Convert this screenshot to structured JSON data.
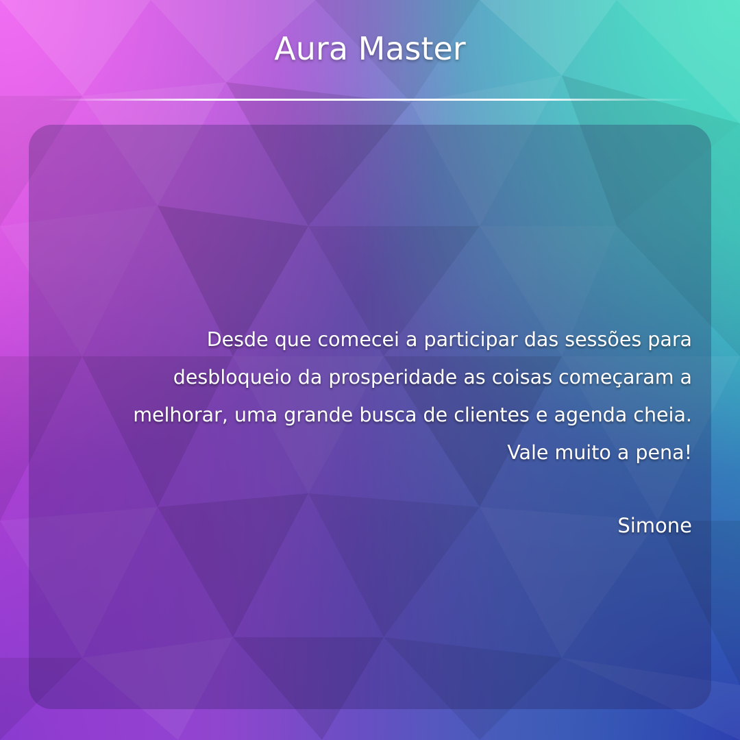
{
  "header": {
    "title": "Aura Master"
  },
  "testimonial": {
    "lines": [
      "Desde que comecei a participar das sessões para",
      "desbloqueio da prosperidade as coisas começaram a",
      "melhorar, uma grande busca de clientes e agenda cheia.",
      "Vale muito a pena!"
    ],
    "author": "Simone"
  },
  "colors": {
    "pink": "#f06ef2",
    "teal": "#4fe3c4",
    "blue": "#2e3fb0",
    "purple": "#8a3bd0",
    "text": "#ffffff"
  }
}
